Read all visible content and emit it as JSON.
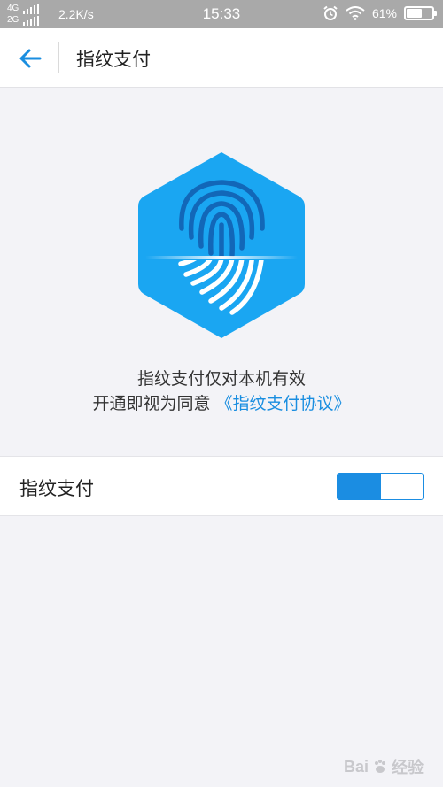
{
  "status_bar": {
    "net_top": "4G",
    "net_bottom": "2G",
    "speed": "2.2K/s",
    "time": "15:33",
    "battery": "61%",
    "battery_level": 0.61,
    "icons": [
      "signal-icon",
      "alarm-icon",
      "wifi-icon",
      "battery-icon"
    ]
  },
  "header": {
    "title": "指纹支付",
    "back_icon": "arrow-left-icon"
  },
  "hero": {
    "icon": "fingerprint-hexagon-icon",
    "line1": "指纹支付仅对本机有效",
    "line2_prefix": "开通即视为同意",
    "line2_link": "《指纹支付协议》"
  },
  "setting": {
    "label": "指纹支付",
    "toggle_on": true
  },
  "watermark": {
    "text": "Bai",
    "suffix": "经验"
  },
  "colors": {
    "accent": "#1b8de2",
    "hex_blue": "#1aa6f2",
    "status_bar": "#a9a9a9",
    "background": "#f3f3f7"
  }
}
